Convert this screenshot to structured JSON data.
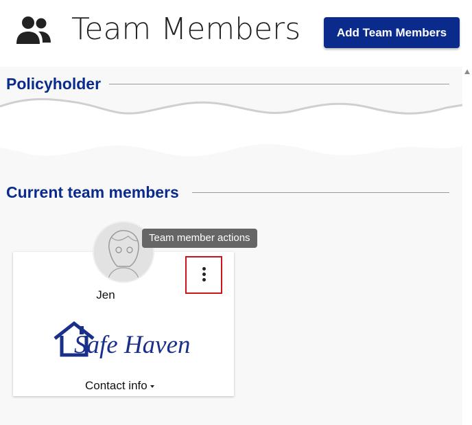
{
  "header": {
    "title": "Team Members",
    "icon": "group-icon",
    "add_button_label": "Add Team Members"
  },
  "sections": {
    "policyholder": {
      "heading": "Policyholder"
    },
    "current": {
      "heading": "Current team members"
    }
  },
  "members": [
    {
      "name": "Jen",
      "avatar": "avatar-photo",
      "actions_tooltip": "Team member actions",
      "actions_icon": "more-vertical-icon",
      "logo_text": "Safe Haven",
      "logo_icon": "house-icon",
      "contact_label": "Contact info",
      "contact_icon": "caret-down-icon"
    }
  ],
  "colors": {
    "brand": "#0a2b8c",
    "highlight": "#d0121b",
    "tooltip_bg": "#666666"
  }
}
